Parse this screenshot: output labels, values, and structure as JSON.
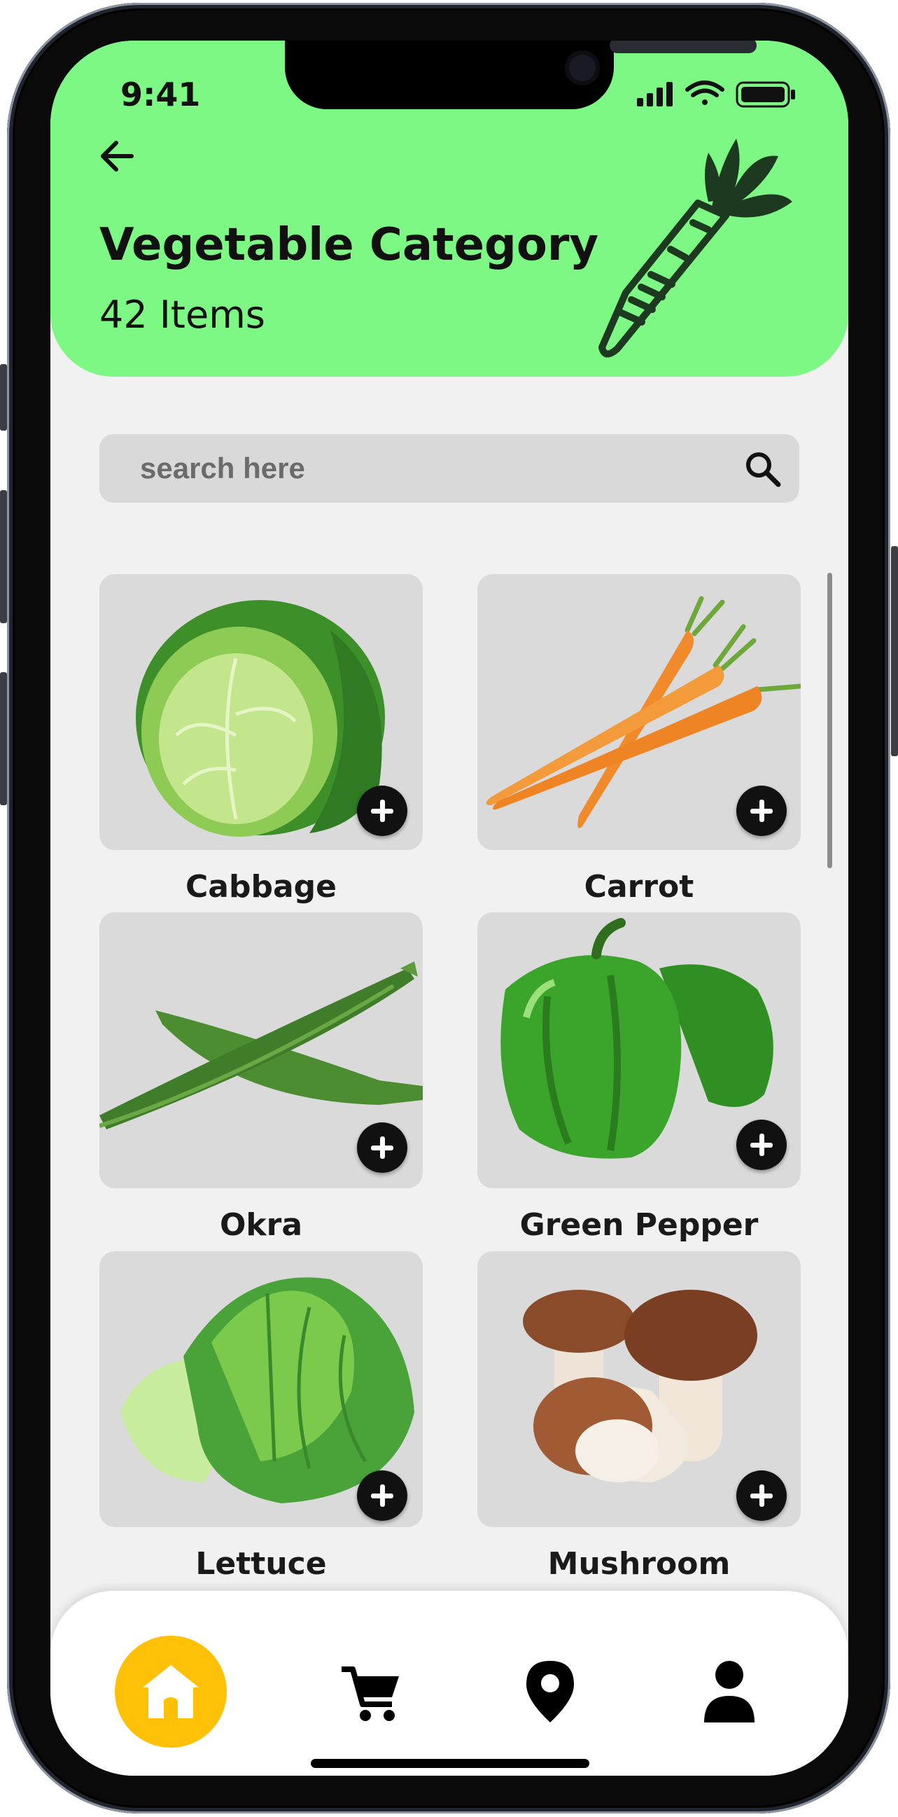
{
  "status": {
    "time": "9:41"
  },
  "header": {
    "title": "Vegetable Category",
    "item_count": "42 Items"
  },
  "search": {
    "placeholder": "search here"
  },
  "products": [
    {
      "name": "Cabbage"
    },
    {
      "name": "Carrot"
    },
    {
      "name": "Okra"
    },
    {
      "name": "Green Pepper"
    },
    {
      "name": "Lettuce"
    },
    {
      "name": "Mushroom"
    }
  ],
  "nav": [
    {
      "icon": "home-icon",
      "active": true
    },
    {
      "icon": "cart-icon",
      "active": false
    },
    {
      "icon": "location-pin-icon",
      "active": false
    },
    {
      "icon": "profile-icon",
      "active": false
    }
  ],
  "colors": {
    "header_bg": "#7ef885",
    "accent": "#ffc107",
    "screen_bg": "#f1f1f1",
    "card_bg": "#dadada"
  }
}
